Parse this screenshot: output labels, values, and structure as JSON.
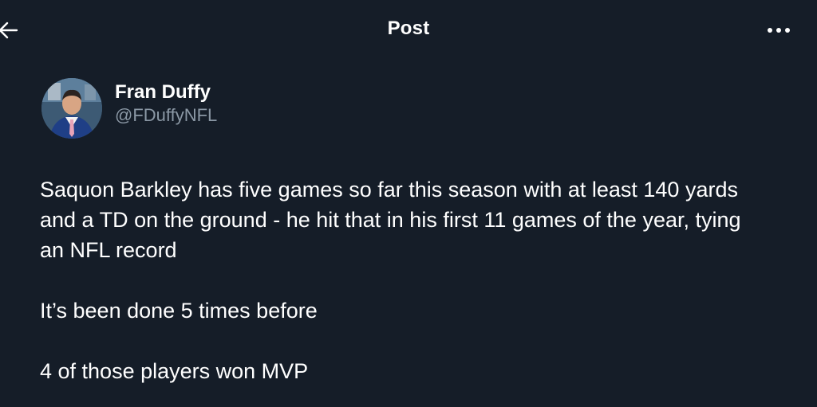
{
  "header": {
    "title": "Post",
    "back_icon": "arrow-left-icon",
    "more_icon": "more-horizontal-icon"
  },
  "author": {
    "display_name": "Fran Duffy",
    "handle": "@FDuffyNFL",
    "avatar_icon": "avatar-photo"
  },
  "post": {
    "paragraphs": [
      "Saquon Barkley has five games so far this season with at least 140 yards and a TD on the ground - he hit that in his first 11 games of the year, tying an NFL record",
      "It’s been done 5 times before",
      "4 of those players won MVP"
    ]
  },
  "colors": {
    "background": "#151d28",
    "text": "#ffffff",
    "secondary_text": "#8b98a5"
  }
}
